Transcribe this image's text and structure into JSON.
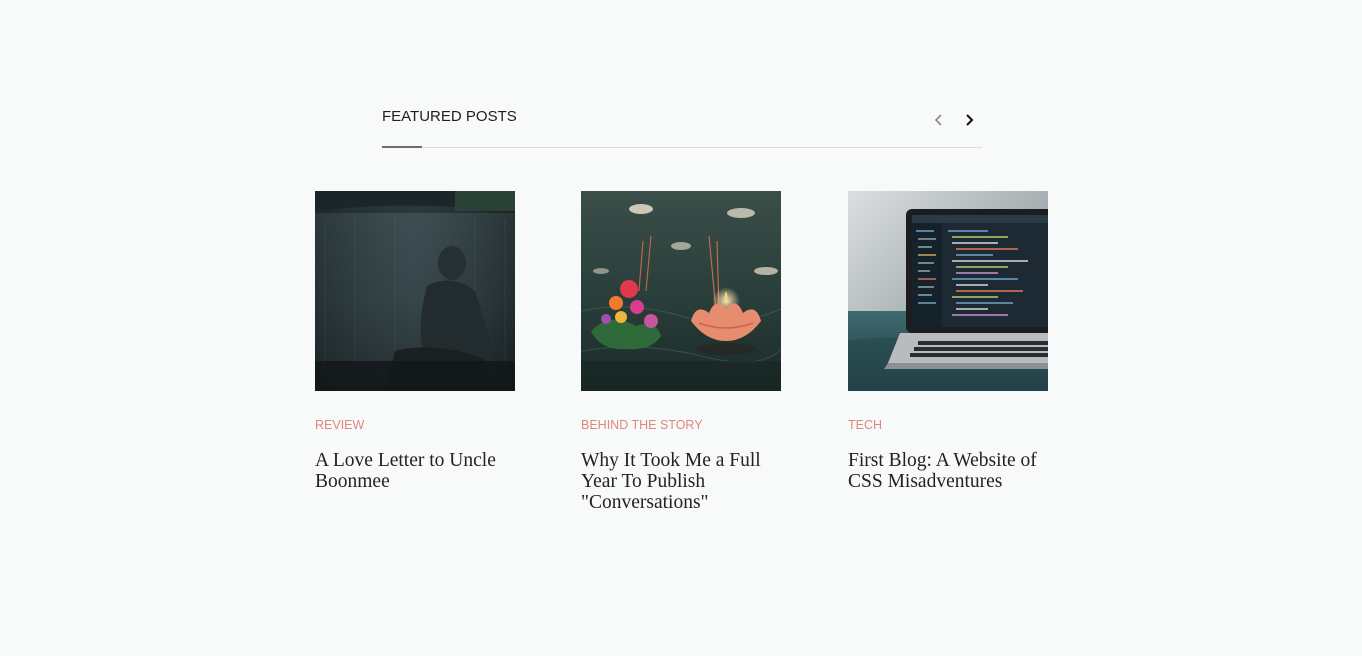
{
  "section": {
    "title": "FEATURED POSTS",
    "prev_icon": "chevron-left-icon",
    "next_icon": "chevron-right-icon"
  },
  "colors": {
    "background": "#f8f9f9",
    "category": "#e08780",
    "title": "#222222",
    "rule": "#dcdcdc",
    "rule_accent": "#6d6d6d"
  },
  "posts": [
    {
      "category": "REVIEW",
      "title": "A Love Letter to Uncle Boonmee",
      "image": "person-under-mosquito-net-image"
    },
    {
      "category": "BEHIND THE STORY",
      "title": "Why It Took Me a Full Year To Publish \"Conversations\"",
      "image": "floating-lotus-candle-image"
    },
    {
      "category": "TECH",
      "title": "First Blog: A Website of CSS Misadventures",
      "image": "laptop-with-code-image"
    }
  ]
}
